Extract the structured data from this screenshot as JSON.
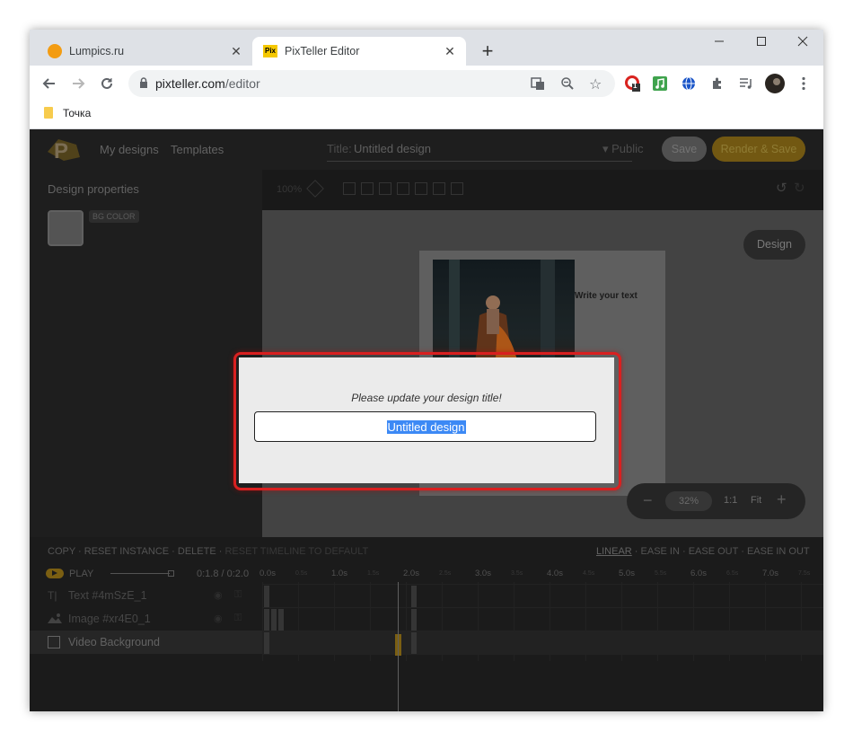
{
  "browser": {
    "tabs": [
      {
        "title": "Lumpics.ru",
        "active": false
      },
      {
        "title": "PixTeller Editor",
        "active": true,
        "favicon_text": "Pix"
      }
    ],
    "window_controls": {
      "minimize": "—",
      "maximize": "☐",
      "close": "✕"
    },
    "url": {
      "domain": "pixteller.com",
      "path": "/editor"
    },
    "extension_badge": "1",
    "bookmarks": [
      {
        "label": "Точка"
      }
    ]
  },
  "app": {
    "nav": {
      "my_designs": "My designs",
      "templates": "Templates"
    },
    "title_label": "Title:",
    "title_value": "Untitled design",
    "visibility": "▾ Public",
    "save_label": "Save",
    "render_label": "Render & Save",
    "design_properties": "Design properties",
    "bg_color_label": "BG COLOR",
    "toolbar_zoom": "100%",
    "canvas_text": "Write your text",
    "design_button": "Design",
    "zoom": {
      "percent": "32%",
      "ratio": "1:1",
      "fit": "Fit"
    }
  },
  "timeline": {
    "actions": [
      "COPY",
      "RESET INSTANCE",
      "DELETE",
      "RESET TIMELINE TO DEFAULT"
    ],
    "easing": [
      "LINEAR",
      "EASE IN",
      "EASE OUT",
      "EASE IN OUT"
    ],
    "easing_selected": "LINEAR",
    "play_label": "PLAY",
    "time": "0:1.8 / 0:2.0",
    "ruler": [
      "0.0s",
      "0.5s",
      "1.0s",
      "1.5s",
      "2.0s",
      "2.5s",
      "3.0s",
      "3.5s",
      "4.0s",
      "4.5s",
      "5.0s",
      "5.5s",
      "6.0s",
      "6.5s",
      "7.0s",
      "7.5s"
    ],
    "layers": [
      {
        "name": "Text #4mSzE_1",
        "type": "text",
        "selected": false
      },
      {
        "name": "Image #xr4E0_1",
        "type": "image",
        "selected": false
      },
      {
        "name": "Video Background",
        "type": "video",
        "selected": true
      }
    ]
  },
  "modal": {
    "message": "Please update your design title!",
    "input_value": "Untitled design"
  },
  "colors": {
    "accent": "#8a6a15",
    "highlight": "#d92020",
    "selection": "#3c89f5"
  }
}
